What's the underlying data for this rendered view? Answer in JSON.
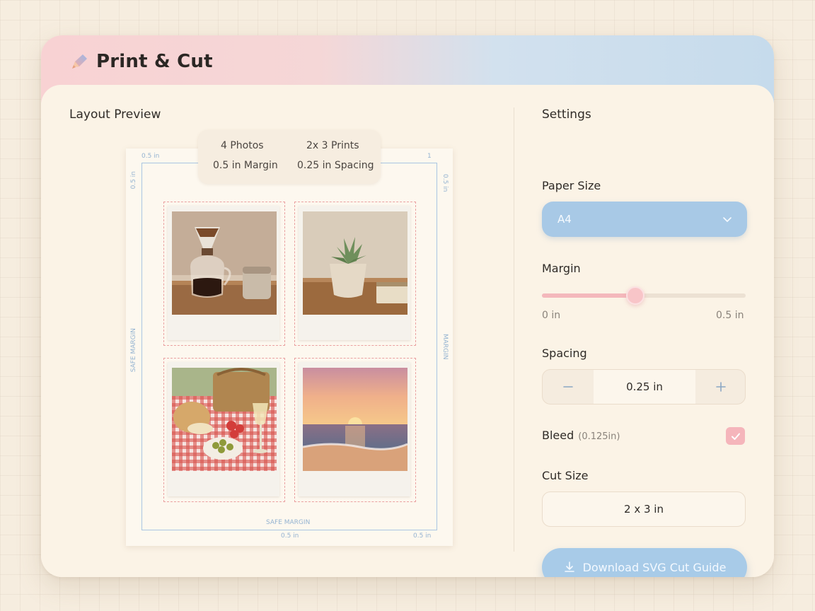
{
  "app": {
    "title": "Print & Cut",
    "icon": "pencil-icon"
  },
  "preview": {
    "title": "Layout Preview",
    "summary": {
      "photos": "4 Photos",
      "prints": "2x 3 Prints",
      "margin": "0.5 in Margin",
      "spacing": "0.25 in Spacing"
    },
    "dimensions": {
      "top_left": "0.5 in",
      "left_top": "0.5 in",
      "right_top": "0.5 in",
      "top_right_tick": "1",
      "left_middle": "SAFE MARGIN",
      "right_middle": "MARGIN",
      "bottom_center": "SAFE MARGIN",
      "bottom_left": "0.5 in",
      "bottom_right": "0.5 in"
    },
    "photos": [
      {
        "subject": "pour-over coffee"
      },
      {
        "subject": "succulent plant"
      },
      {
        "subject": "picnic spread"
      },
      {
        "subject": "beach sunset"
      }
    ]
  },
  "settings": {
    "title": "Settings",
    "paper_size": {
      "label": "Paper Size",
      "value": "A4"
    },
    "margin": {
      "label": "Margin",
      "min_label": "0 in",
      "max_label": "0.5 in",
      "value": 0.23,
      "min": 0,
      "max": 0.5
    },
    "spacing": {
      "label": "Spacing",
      "value": "0.25 in"
    },
    "bleed": {
      "label": "Bleed",
      "note": "(0.125in)",
      "checked": true
    },
    "cut_size": {
      "label": "Cut Size",
      "value": "2 x 3 in"
    },
    "download": {
      "label": "Download SVG Cut Guide"
    }
  },
  "colors": {
    "accent_pink": "#f5b5bb",
    "accent_blue": "#a8c9e6",
    "background": "#fbf3e6"
  }
}
